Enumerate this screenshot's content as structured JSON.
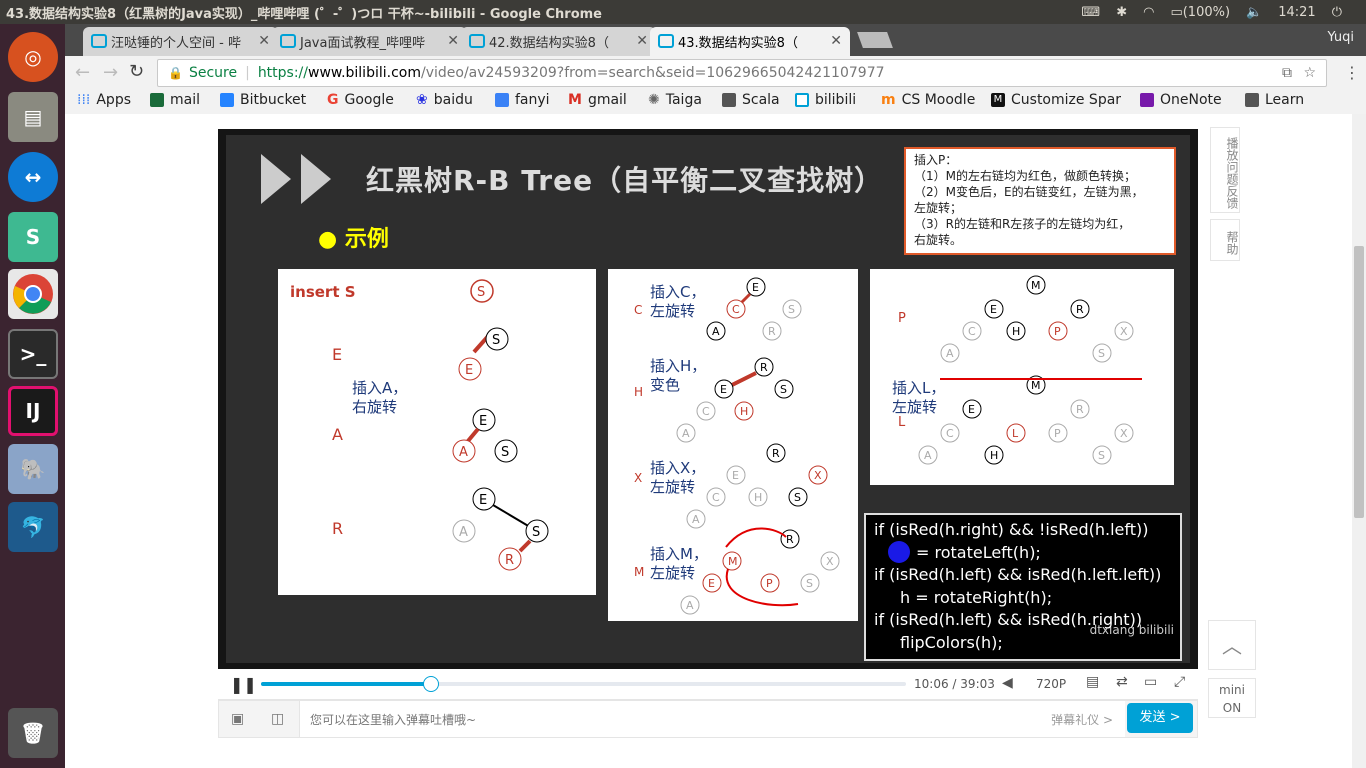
{
  "window": {
    "title": "43.数据结构实验8（红黑树的Java实现）_哔哩哔哩 (゜-゜)つロ 干杯~-bilibili - Google Chrome",
    "battery": "(100%)",
    "time": "14:21"
  },
  "tabs": [
    {
      "label": "汪哒锤的个人空间 - 哔",
      "active": false
    },
    {
      "label": "Java面试教程_哔哩哔",
      "active": false
    },
    {
      "label": "42.数据结构实验8（",
      "active": false
    },
    {
      "label": "43.数据结构实验8（",
      "active": true
    }
  ],
  "profile_name": "Yuqi",
  "address": {
    "secure_label": "Secure",
    "url_scheme": "https://",
    "url_host": "www.bilibili.com",
    "url_rest": "/video/av24593209?from=search&seid=10629665042421107977"
  },
  "bookmarks": [
    {
      "label": "Apps",
      "color": "#4285f4"
    },
    {
      "label": "mail",
      "color": "#1a6b3a"
    },
    {
      "label": "Bitbucket",
      "color": "#2684ff"
    },
    {
      "label": "Google",
      "color": "#ea4335"
    },
    {
      "label": "baidu",
      "color": "#2932e1"
    },
    {
      "label": "fanyi",
      "color": "#3b82f6"
    },
    {
      "label": "gmail",
      "color": "#d93025"
    },
    {
      "label": "Taiga",
      "color": "#666666"
    },
    {
      "label": "Scala",
      "color": "#555555"
    },
    {
      "label": "bilibili",
      "color": "#00a1d6"
    },
    {
      "label": "CS Moodle",
      "color": "#f98012"
    },
    {
      "label": "Customize Spar",
      "color": "#111111"
    },
    {
      "label": "OneNote",
      "color": "#7719aa"
    },
    {
      "label": "Learn",
      "color": "#555555"
    }
  ],
  "slide": {
    "title": "红黑树R-B Tree（自平衡二叉查找树）",
    "bullet": "示例",
    "note_box": {
      "line1": "插入P：",
      "line2": "（1）M的左右链均为红色，做颜色转换；",
      "line3": "（2）M变色后，E的右链变红，左链为黑，",
      "line4": "左旋转；",
      "line5": "（3）R的左链和R左孩子的左链均为红，",
      "line6": "右旋转。"
    },
    "panel1": {
      "insert_label": "insert S",
      "step_E": "E",
      "step_A": "A",
      "step_R": "R",
      "rotate_note_1": "插入A，",
      "rotate_note_2": "右旋转"
    },
    "panel2": {
      "c_label": "C",
      "c_note_1": "插入C，",
      "c_note_2": "左旋转",
      "h_label": "H",
      "h_note_1": "插入H，",
      "h_note_2": "变色",
      "x_label": "X",
      "x_note_1": "插入X，",
      "x_note_2": "左旋转",
      "m_label": "M",
      "m_note_1": "插入M，",
      "m_note_2": "左旋转"
    },
    "panel3": {
      "p_label": "P",
      "l_label": "L",
      "l_note_1": "插入L，",
      "l_note_2": "左旋转"
    },
    "code": [
      "if (isRed(h.right) && !isRed(h.left))",
      "= rotateLeft(h);",
      "if (isRed(h.left)  &&  isRed(h.left.left))",
      "h = rotateRight(h);",
      "if (isRed(h.left)  &&  isRed(h.right))",
      "flipColors(h);"
    ],
    "watermark": "dtxiang bilibili"
  },
  "player": {
    "current_time": "10:06",
    "separator": "/",
    "duration": "39:03",
    "quality": "720P",
    "progress": 0.264
  },
  "danmu": {
    "placeholder": "您可以在这里输入弹幕吐槽哦~",
    "etiquette": "弹幕礼仪 >",
    "send": "发送 >"
  },
  "sidepanel": {
    "feedback": "播放问题反馈",
    "help": "帮助",
    "mini_1": "mini",
    "mini_2": "ON"
  }
}
